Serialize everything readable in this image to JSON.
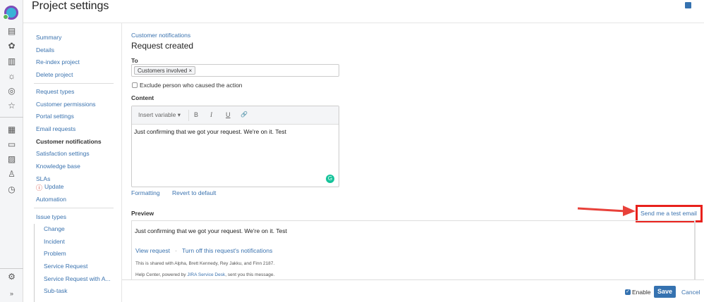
{
  "header": {
    "title": "Project settings"
  },
  "sidebar": {
    "items": [
      "Summary",
      "Details",
      "Re-index project",
      "Delete project",
      "Request types",
      "Customer permissions",
      "Portal settings",
      "Email requests",
      "Customer notifications",
      "Satisfaction settings",
      "Knowledge base",
      "SLAs",
      "Update",
      "Automation",
      "Issue types",
      "Change",
      "Incident",
      "Problem",
      "Service Request",
      "Service Request with A...",
      "Sub-task"
    ]
  },
  "main": {
    "breadcrumb": "Customer notifications",
    "heading": "Request created",
    "to_label": "To",
    "to_chip": "Customers involved",
    "chip_remove": "×",
    "exclude_label": "Exclude person who caused the action",
    "content_label": "Content",
    "insert_variable": "Insert variable ▾",
    "bold": "B",
    "italic": "I",
    "underline": "U",
    "link": "🔗",
    "content_text": "Just confirming that we got your request. We're on it. Test",
    "formatting": "Formatting",
    "revert": "Revert to default",
    "preview_label": "Preview",
    "send_test": "Send me a test email",
    "preview": {
      "text": "Just confirming that we got your request. We're on it. Test",
      "view_request": "View request",
      "sep": "·",
      "turn_off": "Turn off this request's notifications",
      "shared": "This is shared with Alpha, Brett Kennedy, Rey Jakku, and Finn 2187.",
      "help_prefix": "Help Center, powered by ",
      "help_link": "JIRA Service Desk",
      "help_suffix": ", sent you this message."
    }
  },
  "footer": {
    "enable": "Enable",
    "save": "Save",
    "cancel": "Cancel"
  },
  "colors": {
    "link": "#3b73af",
    "primary": "#3572b0",
    "highlight": "#e8211c"
  }
}
